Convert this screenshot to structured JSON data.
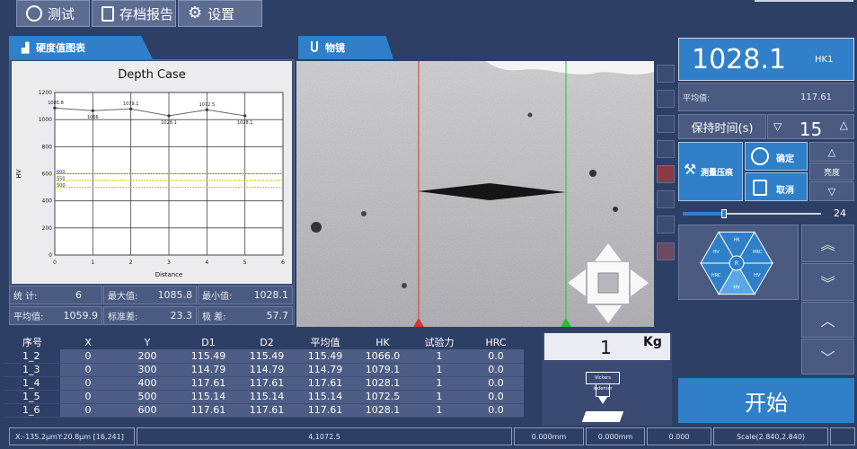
{
  "topbar": {
    "test_label": "测试",
    "report_label": "存档报告",
    "settings_label": "设置"
  },
  "chart_tab_label": "硬度值图表",
  "microscope_tab_label": "物镜",
  "chart_data": {
    "type": "line",
    "title": "Depth Case",
    "xlabel": "Distance",
    "ylabel": "HV",
    "x_ticks": [
      "0",
      "1",
      "2",
      "3",
      "4",
      "5",
      "6"
    ],
    "y_ticks": [
      "0",
      "200",
      "400",
      "600",
      "800",
      "1000",
      "1200"
    ],
    "xlim": [
      0,
      6
    ],
    "ylim": [
      0,
      1200
    ],
    "grid": true,
    "series": [
      {
        "values": [
          [
            0,
            1085.8
          ],
          [
            1,
            1066
          ],
          [
            2,
            1079.1
          ],
          [
            3,
            1028.1
          ],
          [
            4,
            1072.5
          ],
          [
            5,
            1028.1
          ]
        ],
        "labels": [
          "1085.8",
          "1066",
          "1079.1",
          "1028.1",
          "1072.5",
          "1028.1"
        ]
      }
    ],
    "reference_lines": [
      {
        "value": 600,
        "label": "600"
      },
      {
        "value": 550,
        "label": "550"
      },
      {
        "value": 500,
        "label": "500"
      }
    ]
  },
  "stats": {
    "count_label": "统 计:",
    "count_value": "6",
    "max_label": "最大值:",
    "max_value": "1085.8",
    "min_label": "最小值:",
    "min_value": "1028.1",
    "avg_label": "平均值:",
    "avg_value": "1059.9",
    "std_label": "标准差:",
    "std_value": "23.3",
    "range_label": "极 差:",
    "range_value": "57.7"
  },
  "table": {
    "headers": [
      "序号",
      "X",
      "Y",
      "D1",
      "D2",
      "平均值",
      "HK",
      "试验力",
      "HRC"
    ],
    "rows": [
      [
        "1_2",
        "0",
        "200",
        "115.49",
        "115.49",
        "115.49",
        "1066.0",
        "1",
        "0.0"
      ],
      [
        "1_3",
        "0",
        "300",
        "114.79",
        "114.79",
        "114.79",
        "1079.1",
        "1",
        "0.0"
      ],
      [
        "1_4",
        "0",
        "400",
        "117.61",
        "117.61",
        "117.61",
        "1028.1",
        "1",
        "0.0"
      ],
      [
        "1_5",
        "0",
        "500",
        "115.14",
        "115.14",
        "115.14",
        "1072.5",
        "1",
        "0.0"
      ],
      [
        "1_6",
        "0",
        "600",
        "117.61",
        "117.61",
        "117.61",
        "1028.1",
        "1",
        "0.0"
      ]
    ]
  },
  "load": {
    "value": "1",
    "unit": "Kg",
    "indenter_label": "Vickers Indenter"
  },
  "result": {
    "value": "1028.1",
    "unit": "HK1",
    "avg_label": "平均值:",
    "avg_value": "117.61"
  },
  "hold": {
    "label": "保持时间(s)",
    "value": "15"
  },
  "actions": {
    "measure_label": "测量压痕",
    "confirm_label": "确定",
    "cancel_label": "取消",
    "brightness_label": "亮度"
  },
  "slider": {
    "value": "24",
    "fraction": 0.3
  },
  "octagon": {
    "center": "R",
    "sectors": [
      "HK",
      "HRC",
      "HV",
      "HV",
      "HRC",
      "HV"
    ]
  },
  "start_label": "开始",
  "statusbar": {
    "coords": "X:-135.2μmY:20.8μm  [16,241]",
    "point": "4,1072.5",
    "d1": "0.000mm",
    "d2": "0.000mm",
    "val": "0.000",
    "scale": "Scale(2.840,2.840)"
  }
}
